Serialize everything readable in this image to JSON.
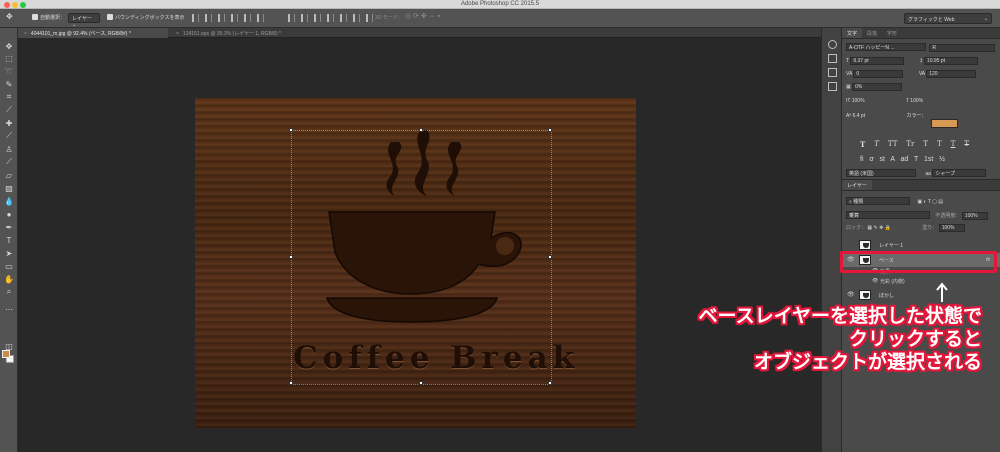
{
  "window": {
    "title": "Adobe Photoshop CC 2015.5"
  },
  "options_bar": {
    "auto_select_label": "自動選択：",
    "auto_select_target": "レイヤー",
    "bounding_box_label": "バウンディングボックスを表示",
    "mode_3d": "3D モード：",
    "workspace": "グラフィックと Web"
  },
  "tabs": [
    {
      "label": "4044101_m.jpg @ 92.4% (ベース, RGB/8#) *"
    },
    {
      "label": "124151.eps @ 35.3% (レイヤー 1, RGB/8) *"
    }
  ],
  "canvas": {
    "artwork_text": "Coffee Break"
  },
  "character_panel": {
    "tabs": [
      "文字",
      "段落",
      "字形"
    ],
    "font_family": "A-OTF ハッピーN ...",
    "font_style": "R",
    "font_size": "9.37 pt",
    "leading": "10.95 pt",
    "kerning": "0",
    "tracking": "120",
    "tsume": "0%",
    "vertical_scale": "100%",
    "horizontal_scale": "100%",
    "baseline_shift": "6.4 pt",
    "color_label": "カラー：",
    "color": "#d89a52",
    "type_styles": [
      "T",
      "T",
      "TT",
      "Tr",
      "T",
      "T",
      "T",
      "T"
    ],
    "language": "英語 (米国)",
    "antialias": "シャープ"
  },
  "layers_panel": {
    "tab": "レイヤー",
    "filter": "種類",
    "blend_mode": "乗算",
    "opacity_label": "不透明度：",
    "opacity": "100%",
    "lock_label": "ロック：",
    "fill_label": "塗り：",
    "fill": "100%",
    "layers": [
      {
        "name": "レイヤー 1",
        "selected": false
      },
      {
        "name": "ベース",
        "selected": true,
        "fx": "fx"
      },
      {
        "name": "ぼかし",
        "selected": false
      }
    ],
    "effects_label": "効果",
    "effect_item": "光彩 (内側)"
  },
  "annotation": {
    "arrow": "↑",
    "lines": [
      "ベースレイヤーを選択した状態で",
      "クリックすると",
      "オブジェクトが選択される"
    ]
  }
}
